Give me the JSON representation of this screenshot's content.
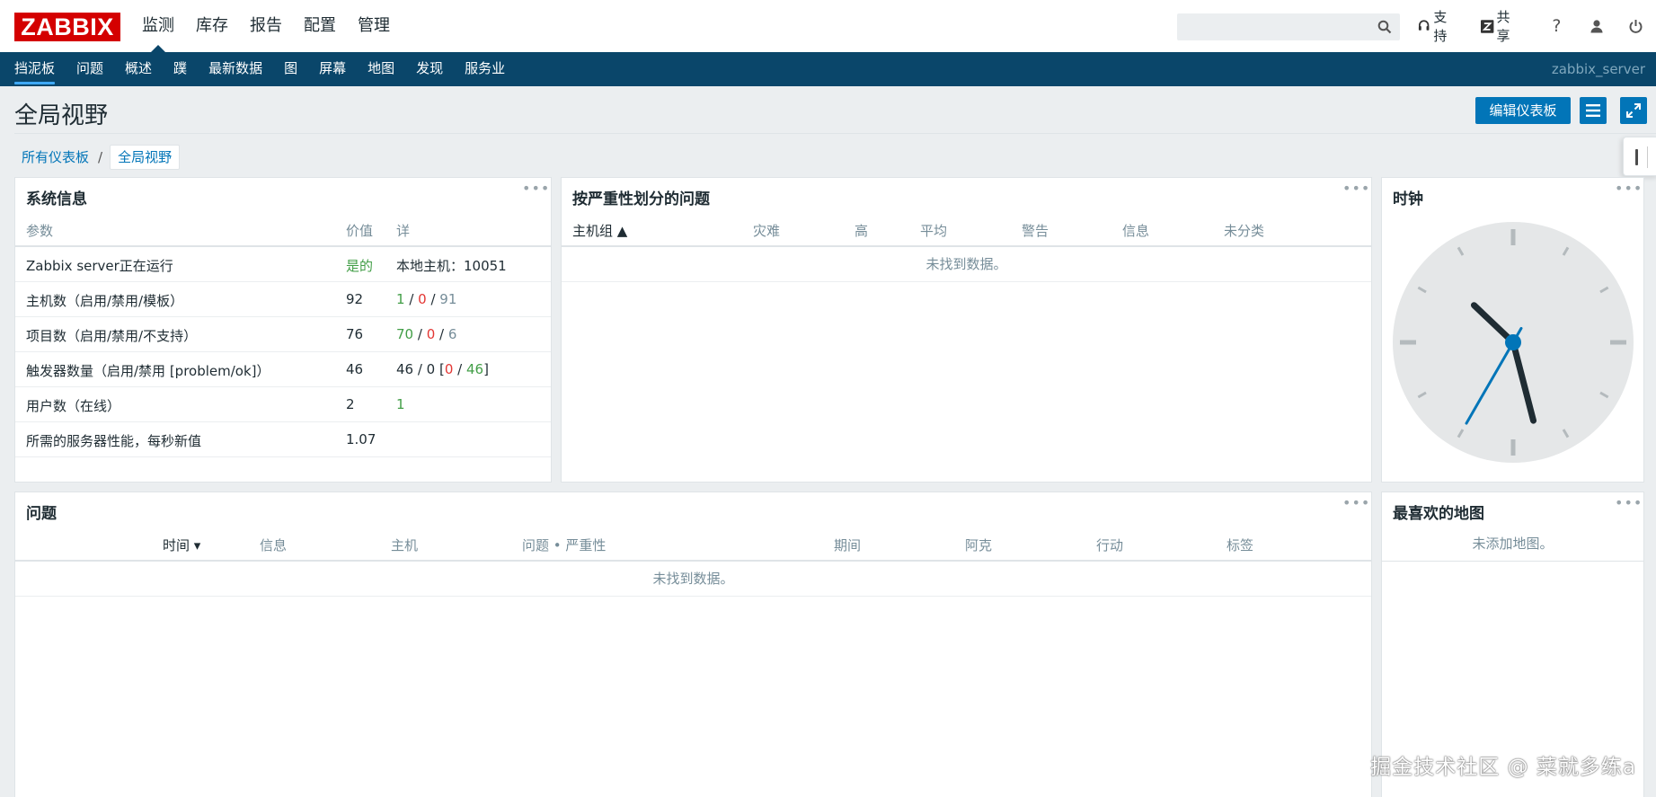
{
  "header": {
    "logo": "ZABBIX",
    "main_menu": [
      "监测",
      "库存",
      "报告",
      "配置",
      "管理"
    ],
    "support": "支持",
    "share": "共享",
    "help": "?"
  },
  "subnav": {
    "items": [
      "挡泥板",
      "问题",
      "概述",
      "蹼",
      "最新数据",
      "图",
      "屏幕",
      "地图",
      "发现",
      "服务业"
    ],
    "server": "zabbix_server"
  },
  "page": {
    "title": "全局视野",
    "edit_button": "编辑仪表板",
    "breadcrumb": [
      "所有仪表板",
      "/",
      "全局视野"
    ]
  },
  "sysinfo": {
    "title": "系统信息",
    "columns": [
      "参数",
      "价值",
      "详"
    ],
    "rows": [
      {
        "param": "Zabbix server正在运行",
        "value": "是的",
        "detail": "本地主机：10051"
      },
      {
        "param": "主机数（启用/禁用/模板）",
        "value": "92",
        "d1": "1",
        "s1": " / ",
        "d2": "0",
        "s2": " / ",
        "d3": "91"
      },
      {
        "param": "项目数（启用/禁用/不支持）",
        "value": "76",
        "d1": "70",
        "s1": " / ",
        "d2": "0",
        "s2": " / ",
        "d3": "6"
      },
      {
        "param": "触发器数量（启用/禁用 [problem/ok]）",
        "value": "46",
        "d0": "46 / 0 [",
        "d1": "0",
        "s1": " / ",
        "d2": "46",
        "d3": "]"
      },
      {
        "param": "用户数（在线）",
        "value": "2",
        "detail": "1"
      },
      {
        "param": "所需的服务器性能，每秒新值",
        "value": "1.07",
        "detail": ""
      }
    ]
  },
  "severity": {
    "title": "按严重性划分的问题",
    "columns": [
      "主机组 ▲",
      "灾难",
      "高",
      "平均",
      "警告",
      "信息",
      "未分类"
    ],
    "empty": "未找到数据。"
  },
  "clock": {
    "title": "时钟",
    "hour": 10,
    "minute": 27,
    "second": 35
  },
  "problems": {
    "title": "问题",
    "columns": [
      "时间 ▾",
      "信息",
      "主机",
      "问题 • 严重性",
      "期间",
      "阿克",
      "行动",
      "标签"
    ],
    "empty": "未找到数据。"
  },
  "maps": {
    "title": "最喜欢的地图",
    "empty": "未添加地图。"
  },
  "watermark": "掘金技术社区 @ 菜就多练a"
}
